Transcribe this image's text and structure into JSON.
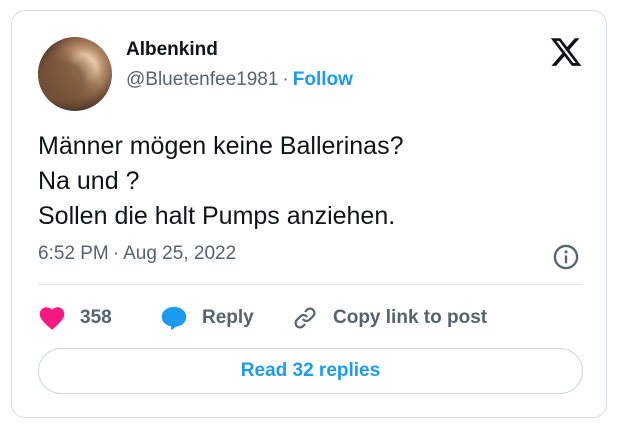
{
  "author": {
    "name": "Albenkind",
    "handle": "@Bluetenfee1981",
    "separator": "·",
    "follow_label": "Follow"
  },
  "tweet": {
    "lines": [
      "Männer mögen keine Ballerinas?",
      "Na und ?",
      "Sollen die halt Pumps anziehen."
    ],
    "time": "6:52 PM",
    "separator": "·",
    "date": "Aug 25, 2022"
  },
  "actions": {
    "like_count": "358",
    "reply_label": "Reply",
    "copy_label": "Copy link to post"
  },
  "read_replies_label": "Read 32 replies",
  "icons": {
    "logo": "x-logo-icon",
    "info": "info-icon",
    "like": "heart-icon",
    "reply": "speech-bubble-icon",
    "copy": "link-icon"
  },
  "colors": {
    "accent": "#1d9bf0",
    "heart": "#f91880",
    "text": "#0f1419",
    "muted": "#536471",
    "border": "#d6dbe0"
  }
}
